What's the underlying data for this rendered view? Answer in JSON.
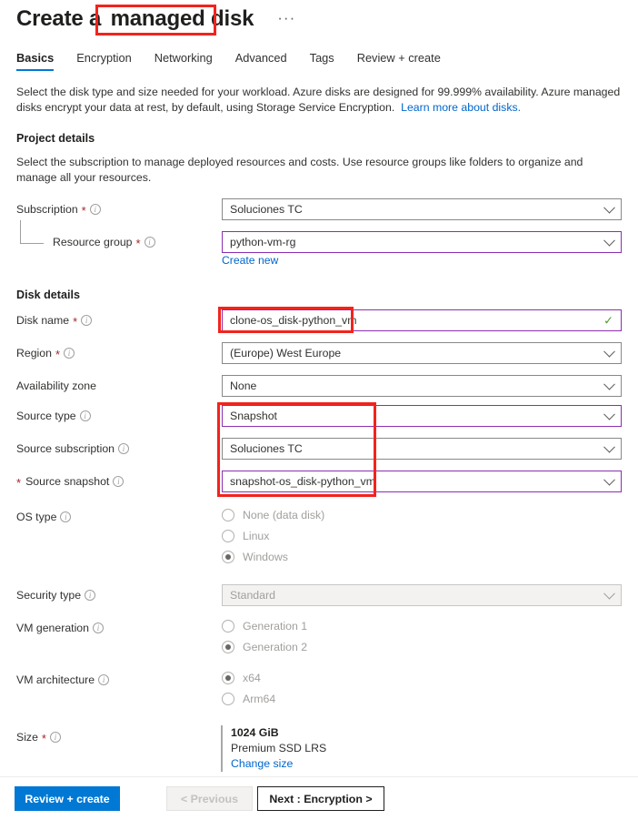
{
  "header": {
    "title_prefix": "Create a ",
    "title_highlight": "managed disk",
    "more_menu": "···"
  },
  "tabs": [
    {
      "label": "Basics",
      "active": true
    },
    {
      "label": "Encryption",
      "active": false
    },
    {
      "label": "Networking",
      "active": false
    },
    {
      "label": "Advanced",
      "active": false
    },
    {
      "label": "Tags",
      "active": false
    },
    {
      "label": "Review + create",
      "active": false
    }
  ],
  "intro": {
    "text": "Select the disk type and size needed for your workload. Azure disks are designed for 99.999% availability. Azure managed disks encrypt your data at rest, by default, using Storage Service Encryption.",
    "link": "Learn more about disks."
  },
  "project_details": {
    "heading": "Project details",
    "description": "Select the subscription to manage deployed resources and costs. Use resource groups like folders to organize and manage all your resources.",
    "subscription": {
      "label": "Subscription",
      "required": "*",
      "value": "Soluciones TC"
    },
    "resource_group": {
      "label": "Resource group",
      "required": "*",
      "value": "python-vm-rg",
      "create_new": "Create new"
    }
  },
  "disk_details": {
    "heading": "Disk details",
    "disk_name": {
      "label": "Disk name",
      "required": "*",
      "value": "clone-os_disk-python_vm"
    },
    "region": {
      "label": "Region",
      "required": "*",
      "value": "(Europe) West Europe"
    },
    "availability_zone": {
      "label": "Availability zone",
      "value": "None"
    },
    "source_type": {
      "label": "Source type",
      "value": "Snapshot"
    },
    "source_subscription": {
      "label": "Source subscription",
      "value": "Soluciones TC"
    },
    "source_snapshot": {
      "label": "Source snapshot",
      "required": "*",
      "value": "snapshot-os_disk-python_vm"
    },
    "os_type": {
      "label": "OS type",
      "options": [
        {
          "label": "None (data disk)",
          "selected": false
        },
        {
          "label": "Linux",
          "selected": false
        },
        {
          "label": "Windows",
          "selected": true
        }
      ]
    },
    "security_type": {
      "label": "Security type",
      "value": "Standard"
    },
    "vm_generation": {
      "label": "VM generation",
      "options": [
        {
          "label": "Generation 1",
          "selected": false
        },
        {
          "label": "Generation 2",
          "selected": true
        }
      ]
    },
    "vm_architecture": {
      "label": "VM architecture",
      "options": [
        {
          "label": "x64",
          "selected": true
        },
        {
          "label": "Arm64",
          "selected": false
        }
      ]
    },
    "size": {
      "label": "Size",
      "required": "*",
      "value": "1024 GiB",
      "sku": "Premium SSD LRS",
      "change_link": "Change size"
    }
  },
  "footer": {
    "review_create": "Review + create",
    "previous": "< Previous",
    "next": "Next : Encryption >"
  },
  "colors": {
    "accent": "#0078d4",
    "annotation": "#f3231b",
    "modified_border": "#8b2fb0",
    "required": "#a4262c",
    "valid_check": "#4f9a32"
  }
}
